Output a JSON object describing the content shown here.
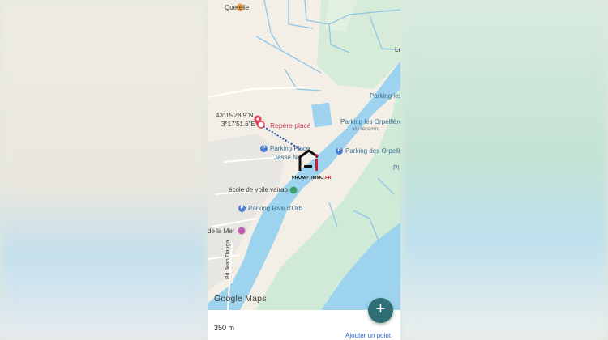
{
  "map": {
    "labels": {
      "querelle": "Querelle",
      "coord_lat": "43°15'28.9\"N",
      "coord_lon": "3°17'51.6\"E",
      "repere": "Repère placé",
      "parking_place": "Parking Place",
      "jasse": "Jasse Na",
      "parking_orpellieres_1": "Parking les Orpellières",
      "vu_recemment": "Vu récemm",
      "parking_des_orpellieres": "Parking des Orpellié",
      "parking_les_top": "Parking les",
      "le_top": "Le",
      "ecole_voile": "école de voile vairao",
      "parking_rive": "Parking Rive d'Orb",
      "de_la_mer": "de la Mer",
      "bd_jean": "Bd Jean Dauga",
      "pl_right": "Pl"
    },
    "brand_name": "PROMPTIMMO",
    "brand_suffix": ".FR",
    "google": "Google Maps"
  },
  "bottom": {
    "scale": "350 m",
    "add_point": "Ajouter un point",
    "fab": "+"
  },
  "colors": {
    "river": "#9dd3ee",
    "land": "#f3efe6",
    "park": "#cfead7",
    "marker_red": "#e0445a",
    "parking_blue": "#4e7fd6"
  }
}
